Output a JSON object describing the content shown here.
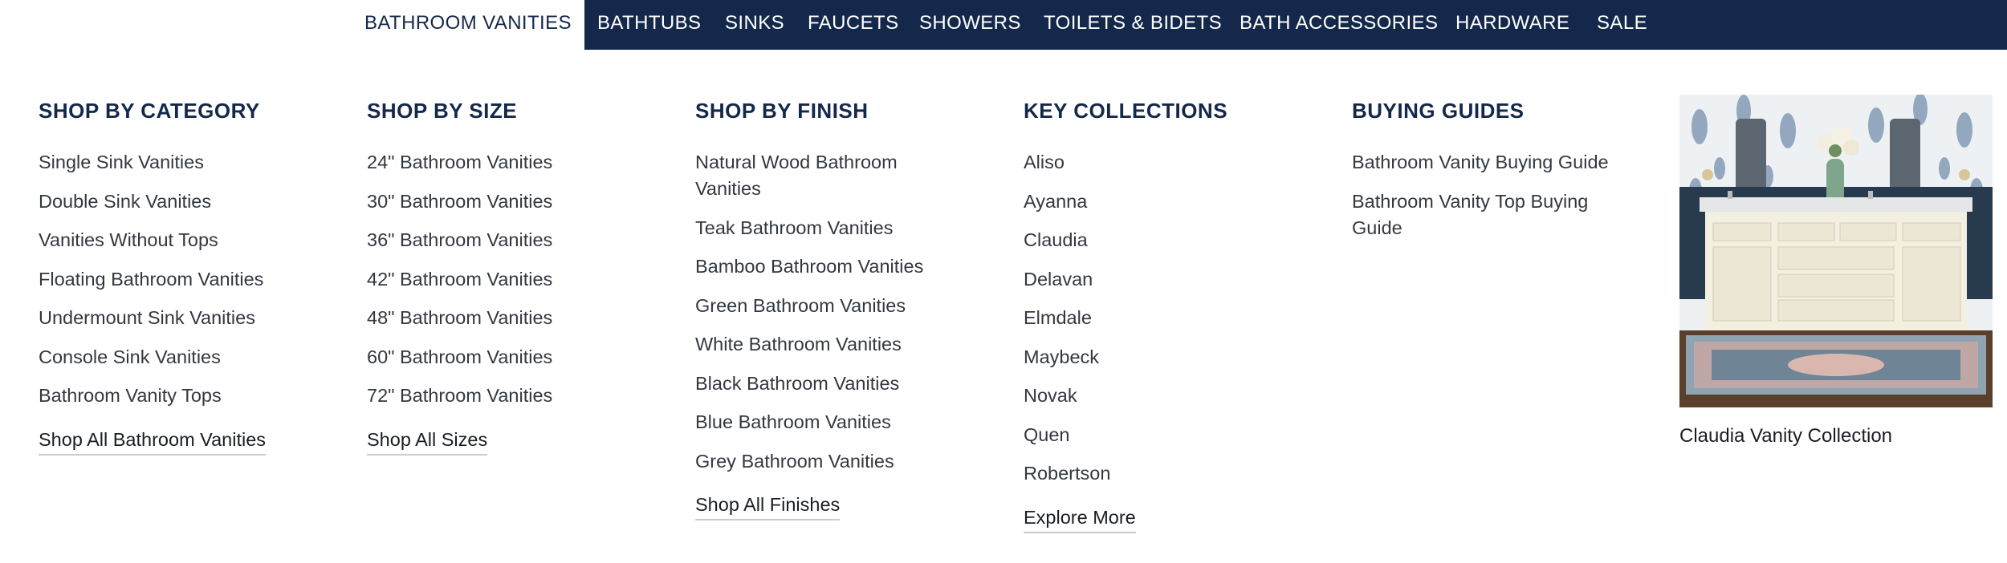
{
  "nav": {
    "items": [
      {
        "label": "BATHROOM VANITIES"
      },
      {
        "label": "BATHTUBS"
      },
      {
        "label": "SINKS"
      },
      {
        "label": "FAUCETS"
      },
      {
        "label": "SHOWERS"
      },
      {
        "label": "TOILETS & BIDETS"
      },
      {
        "label": "BATH ACCESSORIES"
      },
      {
        "label": "HARDWARE"
      },
      {
        "label": "SALE"
      }
    ],
    "active_color": "#14284b",
    "bar_color": "#14284b"
  },
  "menu": {
    "category": {
      "title": "SHOP BY CATEGORY",
      "links": [
        "Single Sink Vanities",
        "Double Sink Vanities",
        "Vanities Without Tops",
        "Floating Bathroom Vanities",
        "Undermount Sink Vanities",
        "Console Sink Vanities",
        "Bathroom Vanity Tops"
      ],
      "shop_all": "Shop All Bathroom Vanities"
    },
    "size": {
      "title": "SHOP BY SIZE",
      "links": [
        "24\" Bathroom Vanities",
        "30\" Bathroom Vanities",
        "36\" Bathroom Vanities",
        "42\" Bathroom Vanities",
        "48\" Bathroom Vanities",
        "60\" Bathroom Vanities",
        "72\" Bathroom Vanities"
      ],
      "shop_all": "Shop All Sizes"
    },
    "finish": {
      "title": "SHOP BY FINISH",
      "links": [
        "Natural Wood Bathroom Vanities",
        "Teak Bathroom Vanities",
        "Bamboo Bathroom Vanities",
        "Green Bathroom Vanities",
        "White Bathroom Vanities",
        "Black Bathroom Vanities",
        "Blue Bathroom Vanities",
        "Grey Bathroom Vanities"
      ],
      "shop_all": "Shop All Finishes"
    },
    "collections": {
      "title": "KEY COLLECTIONS",
      "links": [
        "Aliso",
        "Ayanna",
        "Claudia",
        "Delavan",
        "Elmdale",
        "Maybeck",
        "Novak",
        "Quen",
        "Robertson"
      ],
      "shop_all": "Explore More"
    },
    "guides": {
      "title": "BUYING GUIDES",
      "links": [
        "Bathroom Vanity Buying Guide",
        "Bathroom Vanity Top Buying Guide"
      ]
    },
    "feature": {
      "caption": "Claudia Vanity Collection"
    }
  }
}
